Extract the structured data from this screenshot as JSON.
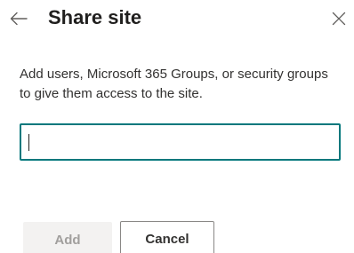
{
  "header": {
    "title": "Share site",
    "back_icon": "arrow-left-icon",
    "close_icon": "close-icon"
  },
  "description": "Add users, Microsoft 365 Groups, or security groups to give them access to the site.",
  "people_input": {
    "value": "",
    "placeholder": "",
    "focus_color": "#03787c"
  },
  "footer": {
    "add_label": "Add",
    "add_disabled": true,
    "cancel_label": "Cancel"
  }
}
